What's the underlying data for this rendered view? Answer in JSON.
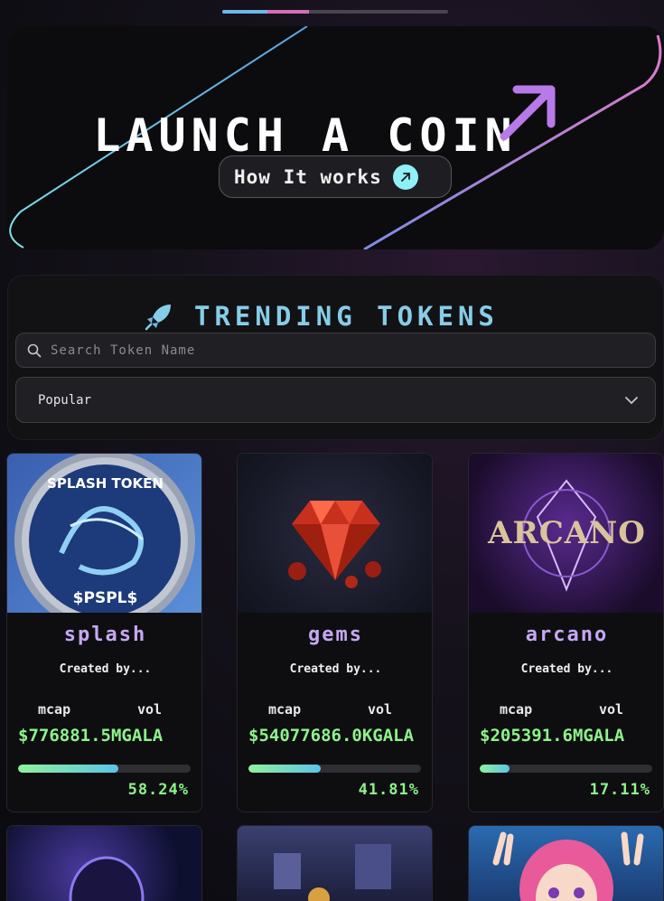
{
  "hero": {
    "title": "LAUNCH A COIN",
    "how_label": "How It works"
  },
  "trending": {
    "title": "TRENDING TOKENS",
    "search_placeholder": "Search Token Name",
    "sort_value": "Popular"
  },
  "tokens": [
    {
      "name": "splash",
      "created_by": "Created by...",
      "mcap_label": "mcap",
      "vol_label": "vol",
      "mcap_value": "$776881.5MGALA",
      "progress": 58.24,
      "progress_text": "58.24%",
      "image_text": "SPLASH TOKEN",
      "image_ticker": "$PSPL$"
    },
    {
      "name": "gems",
      "created_by": "Created by...",
      "mcap_label": "mcap",
      "vol_label": "vol",
      "mcap_value": "$54077686.0KGALA",
      "progress": 41.81,
      "progress_text": "41.81%"
    },
    {
      "name": "arcano",
      "created_by": "Created by...",
      "mcap_label": "mcap",
      "vol_label": "vol",
      "mcap_value": "$205391.6MGALA",
      "progress": 17.11,
      "progress_text": "17.11%",
      "image_text": "ARCANO"
    }
  ],
  "colors": {
    "accent_purple": "#c6a8f6",
    "accent_green": "#8df48a",
    "accent_cyan": "#86cde8"
  }
}
